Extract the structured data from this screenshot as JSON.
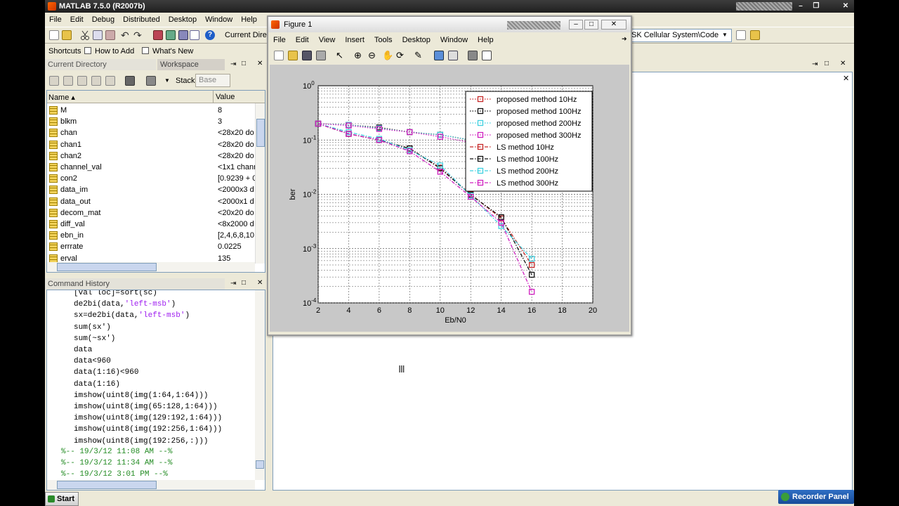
{
  "app": {
    "title": "MATLAB  7.5.0 (R2007b)",
    "menu": [
      "File",
      "Edit",
      "Debug",
      "Distributed",
      "Desktop",
      "Window",
      "Help"
    ],
    "current_directory_label": "Current Directory:",
    "current_directory_value": "SK Cellular System\\Code",
    "shortcuts": [
      "Shortcuts",
      "How to Add",
      "What's New"
    ]
  },
  "panels": {
    "current_directory_tab": "Current Directory",
    "workspace_tab": "Workspace",
    "stack_label": "Stack:",
    "stack_value": "Base",
    "name_header": "Name ▴",
    "value_header": "Value",
    "command_history_title": "Command History"
  },
  "workspace": [
    {
      "name": "M",
      "value": "8"
    },
    {
      "name": "blkm",
      "value": "3"
    },
    {
      "name": "chan",
      "value": "<28x20 do"
    },
    {
      "name": "chan1",
      "value": "<28x20 do"
    },
    {
      "name": "chan2",
      "value": "<28x20 do"
    },
    {
      "name": "channel_val",
      "value": "<1x1 chann"
    },
    {
      "name": "con2",
      "value": "[0.9239 + 0"
    },
    {
      "name": "data_im",
      "value": "<2000x3 d"
    },
    {
      "name": "data_out",
      "value": "<2000x1 d"
    },
    {
      "name": "decom_mat",
      "value": "<20x20 do"
    },
    {
      "name": "diff_val",
      "value": "<8x2000 d"
    },
    {
      "name": "ebn_in",
      "value": "[2,4,6,8,10"
    },
    {
      "name": "errrate",
      "value": "0.0225"
    },
    {
      "name": "erval",
      "value": "135"
    }
  ],
  "history": [
    {
      "pre": "[val loc]=sort(sc)",
      "str": "",
      "post": ""
    },
    {
      "pre": "de2bi(data,",
      "str": "'left-msb'",
      "post": ")"
    },
    {
      "pre": "sx=de2bi(data,",
      "str": "'left-msb'",
      "post": ")"
    },
    {
      "pre": "sum(sx')",
      "str": "",
      "post": ""
    },
    {
      "pre": "sum(~sx')",
      "str": "",
      "post": ""
    },
    {
      "pre": "data",
      "str": "",
      "post": ""
    },
    {
      "pre": "data<960",
      "str": "",
      "post": ""
    },
    {
      "pre": "data(1:16)<960",
      "str": "",
      "post": ""
    },
    {
      "pre": "data(1:16)",
      "str": "",
      "post": ""
    },
    {
      "pre": "imshow(uint8(img(1:64,1:64)))",
      "str": "",
      "post": ""
    },
    {
      "pre": "imshow(uint8(img(65:128,1:64)))",
      "str": "",
      "post": ""
    },
    {
      "pre": "imshow(uint8(img(129:192,1:64)))",
      "str": "",
      "post": ""
    },
    {
      "pre": "imshow(uint8(img(192:256,1:64)))",
      "str": "",
      "post": ""
    },
    {
      "pre": "imshow(uint8(img(192:256,:)))",
      "str": "",
      "post": ""
    }
  ],
  "history_separators": [
    "%-- 19/3/12 11:08 AM --%",
    "%-- 19/3/12 11:34 AM --%",
    "%-- 19/3/12  3:01 PM --%"
  ],
  "figure": {
    "title": "Figure 1",
    "menu": [
      "File",
      "Edit",
      "View",
      "Insert",
      "Tools",
      "Desktop",
      "Window",
      "Help"
    ]
  },
  "taskbar": {
    "start": "Start",
    "recorder": "Recorder Panel"
  },
  "chart_data": {
    "type": "line",
    "xlabel": "Eb/N0",
    "ylabel": "ber",
    "xlim": [
      2,
      20
    ],
    "ylim": [
      0.0001,
      1
    ],
    "yscale": "log",
    "grid": true,
    "legend_position": "top-right",
    "x_ticks": [
      "2",
      "4",
      "6",
      "8",
      "10",
      "12",
      "14",
      "16",
      "18",
      "20"
    ],
    "y_ticks": [
      {
        "base": "10",
        "exp": "0"
      },
      {
        "base": "10",
        "exp": "-1"
      },
      {
        "base": "10",
        "exp": "-2"
      },
      {
        "base": "10",
        "exp": "-3"
      },
      {
        "base": "10",
        "exp": "-4"
      }
    ],
    "series": [
      {
        "name": "proposed method 10Hz",
        "color": "#c62828",
        "style": "dotted",
        "x": [
          2,
          4,
          6,
          8,
          10,
          12,
          14,
          16
        ],
        "y": [
          0.2,
          0.19,
          0.17,
          0.14,
          0.125,
          0.1,
          0.075,
          0.04
        ]
      },
      {
        "name": "proposed method 100Hz",
        "color": "#111111",
        "style": "dotted",
        "x": [
          2,
          4,
          6,
          8,
          10,
          12,
          14,
          16
        ],
        "y": [
          0.2,
          0.19,
          0.17,
          0.14,
          0.125,
          0.1,
          0.075,
          0.04
        ]
      },
      {
        "name": "proposed method 200Hz",
        "color": "#40d0e0",
        "style": "dotted",
        "x": [
          2,
          4,
          6,
          8,
          10,
          12,
          14,
          16
        ],
        "y": [
          0.2,
          0.19,
          0.165,
          0.14,
          0.125,
          0.1,
          0.075,
          0.04
        ]
      },
      {
        "name": "proposed method 300Hz",
        "color": "#d020c0",
        "style": "dotted",
        "x": [
          2,
          4,
          6,
          8,
          10,
          12,
          14,
          16
        ],
        "y": [
          0.2,
          0.185,
          0.16,
          0.14,
          0.115,
          0.09,
          0.07,
          0.035
        ]
      },
      {
        "name": "LS method 10Hz",
        "color": "#c62828",
        "style": "dashdot",
        "x": [
          2,
          4,
          6,
          8,
          10,
          12,
          14,
          16
        ],
        "y": [
          0.2,
          0.13,
          0.1,
          0.07,
          0.031,
          0.01,
          0.0036,
          0.0005
        ]
      },
      {
        "name": "LS method 100Hz",
        "color": "#111111",
        "style": "dashdot",
        "x": [
          2,
          4,
          6,
          8,
          10,
          12,
          14,
          16
        ],
        "y": [
          0.2,
          0.13,
          0.1,
          0.07,
          0.03,
          0.0098,
          0.0038,
          0.00033
        ]
      },
      {
        "name": "LS method 200Hz",
        "color": "#40d0e0",
        "style": "dashdot",
        "x": [
          2,
          4,
          6,
          8,
          10,
          12,
          14,
          16
        ],
        "y": [
          0.2,
          0.14,
          0.105,
          0.065,
          0.034,
          0.0095,
          0.0026,
          0.00065
        ]
      },
      {
        "name": "LS method 300Hz",
        "color": "#d020c0",
        "style": "dashdot",
        "x": [
          2,
          4,
          6,
          8,
          10,
          12,
          14,
          16
        ],
        "y": [
          0.2,
          0.13,
          0.1,
          0.062,
          0.026,
          0.009,
          0.003,
          0.00016
        ]
      }
    ]
  }
}
